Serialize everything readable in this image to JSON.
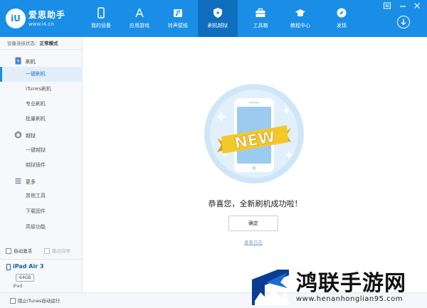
{
  "app": {
    "brand_name": "爱思助手",
    "brand_url": "www.i4.cn",
    "brand_badge": "iU"
  },
  "nav": [
    {
      "label": "我的设备",
      "icon": "device-icon"
    },
    {
      "label": "应用游戏",
      "icon": "app-store-icon"
    },
    {
      "label": "铃声壁纸",
      "icon": "ringtone-icon"
    },
    {
      "label": "刷机越狱",
      "icon": "flash-icon",
      "active": true
    },
    {
      "label": "工具箱",
      "icon": "toolbox-icon"
    },
    {
      "label": "教程中心",
      "icon": "graduation-cap-icon"
    },
    {
      "label": "发现",
      "icon": "compass-icon"
    }
  ],
  "sidebar": {
    "status_label": "设备连接状态：",
    "status_value": "正常模式",
    "groups": [
      {
        "label": "刷机",
        "icon": "flash-phone-icon",
        "items": [
          "一键刷机",
          "iTunes刷机",
          "专业刷机",
          "批量刷机"
        ]
      },
      {
        "label": "越狱",
        "icon": "jailbreak-icon",
        "items": [
          "一键越狱",
          "越狱插件"
        ]
      },
      {
        "label": "更多",
        "icon": "more-icon",
        "items": [
          "其他工具",
          "下载固件",
          "高级功能"
        ]
      }
    ],
    "active_item": "一键刷机",
    "auto_activate": "自动激活",
    "skip_guide": "跳过向导",
    "device": {
      "name": "iPad Air 3",
      "capacity": "64GB",
      "type": "iPad"
    }
  },
  "bottom": {
    "block_itunes": "阻止iTunes自动运行"
  },
  "main": {
    "badge_text": "NEW",
    "success_message": "恭喜您，全新刷机成功啦！",
    "ok_button": "确定",
    "log_link": "查看日志"
  },
  "watermark": {
    "title": "鸿联手游网",
    "url": "www.henanhonglian95.com"
  },
  "colors": {
    "topbar": "#1a8ee6",
    "active_nav": "#0f6fbe",
    "ribbon": "#f3c829",
    "hero_circle": "#cfe6f8"
  }
}
